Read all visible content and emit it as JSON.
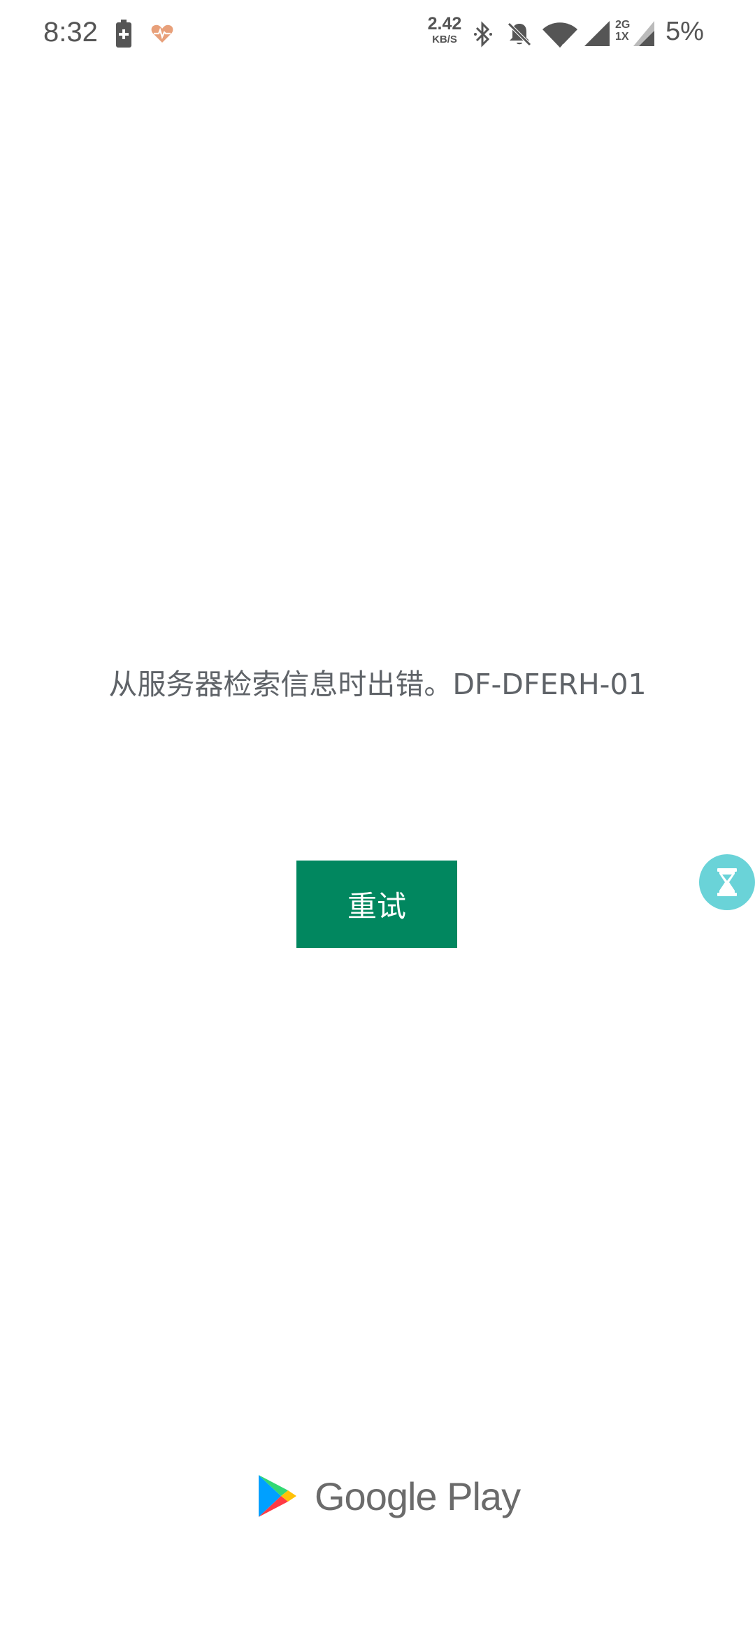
{
  "status_bar": {
    "time": "8:32",
    "net_speed_value": "2.42",
    "net_speed_unit": "KB/S",
    "net_type_top": "2G",
    "net_type_bottom": "1X",
    "battery_percent": "5%",
    "icons": [
      "battery-charging-icon",
      "health-heart-icon",
      "bluetooth-icon",
      "bell-muted-icon",
      "wifi-icon",
      "signal-icon",
      "signal-2-icon"
    ]
  },
  "main": {
    "error_message": "从服务器检索信息时出错。DF-DFERH-01",
    "retry_label": "重试"
  },
  "footer": {
    "brand": "Google Play"
  },
  "colors": {
    "primary": "#01875f",
    "text": "#5f6368",
    "bubble": "#6ad3d8"
  }
}
